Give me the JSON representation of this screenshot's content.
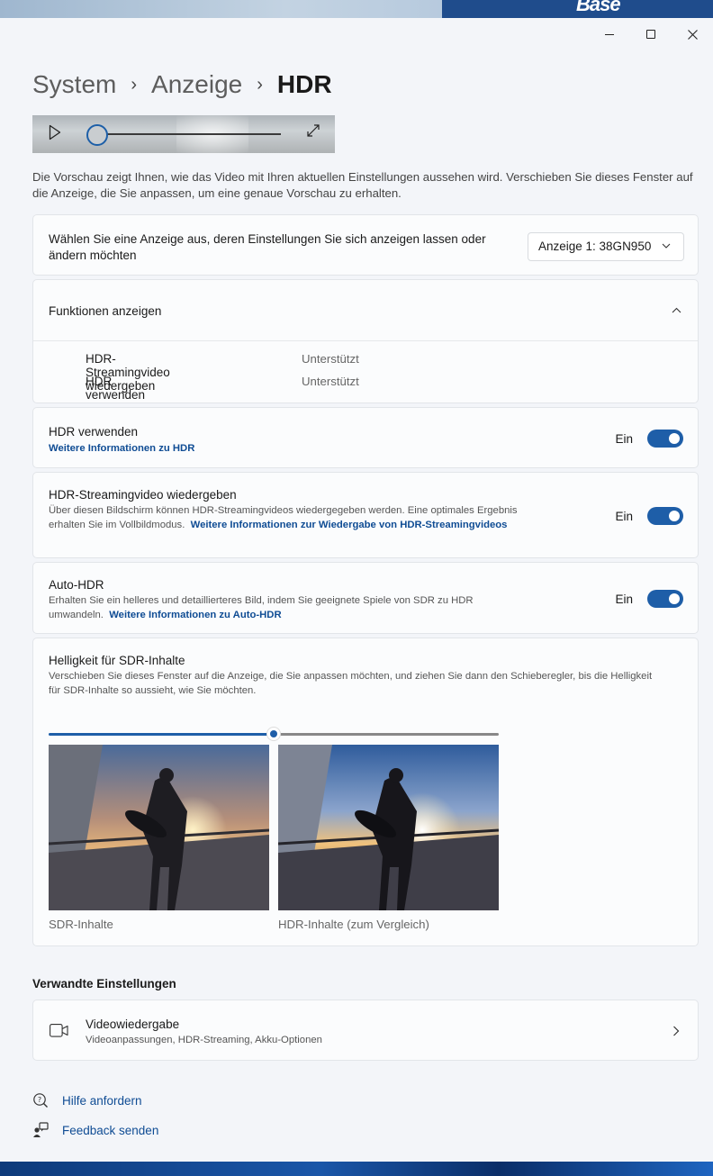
{
  "topbar": {
    "brand": "Base"
  },
  "breadcrumb": {
    "items": [
      "System",
      "Anzeige"
    ],
    "current": "HDR",
    "separator": "›"
  },
  "preview": {
    "progress": 0.0,
    "description": "Die Vorschau zeigt Ihnen, wie das Video mit Ihren aktuellen Einstellungen aussehen wird. Verschieben Sie dieses Fenster auf die Anzeige, die Sie anpassen, um eine genaue Vorschau zu erhalten."
  },
  "display_select": {
    "label": "Wählen Sie eine Anzeige aus, deren Einstellungen Sie sich anzeigen lassen oder ändern möchten",
    "value": "Anzeige 1: 38GN950"
  },
  "features": {
    "header": "Funktionen anzeigen",
    "rows": [
      {
        "label": "HDR-Streamingvideo wiedergeben",
        "value": "Unterstützt"
      },
      {
        "label": "HDR verwenden",
        "value": "Unterstützt"
      }
    ]
  },
  "settings": {
    "hdr": {
      "title": "HDR verwenden",
      "link": "Weitere Informationen zu HDR",
      "state": "Ein",
      "on": true
    },
    "streaming": {
      "title": "HDR-Streamingvideo wiedergeben",
      "text": "Über diesen Bildschirm können HDR-Streamingvideos wiedergegeben werden. Eine optimales Ergebnis erhalten Sie im Vollbildmodus.",
      "link": "Weitere Informationen zur Wiedergabe von HDR-Streamingvideos",
      "state": "Ein",
      "on": true
    },
    "autohdr": {
      "title": "Auto-HDR",
      "text": "Erhalten Sie ein helleres und detaillierteres Bild, indem Sie geeignete Spiele von SDR zu HDR umwandeln.",
      "link": "Weitere Informationen zu Auto-HDR",
      "state": "Ein",
      "on": true
    }
  },
  "sdr_brightness": {
    "title": "Helligkeit für SDR-Inhalte",
    "text": "Verschieben Sie dieses Fenster auf die Anzeige, die Sie anpassen möchten, und ziehen Sie dann den Schieberegler, bis die Helligkeit für SDR-Inhalte so aussieht, wie Sie möchten.",
    "slider_value": 0.5,
    "captions": {
      "sdr": "SDR-Inhalte",
      "hdr": "HDR-Inhalte (zum Vergleich)"
    }
  },
  "related": {
    "heading": "Verwandte Einstellungen",
    "item": {
      "title": "Videowiedergabe",
      "subtitle": "Videoanpassungen, HDR-Streaming, Akku-Optionen"
    }
  },
  "footer": {
    "help": "Hilfe anfordern",
    "feedback": "Feedback senden"
  },
  "colors": {
    "accent": "#1e5ea8",
    "link": "#0f4c94",
    "background": "#f3f5f9",
    "card": "#fbfcfd"
  },
  "icons": {
    "play": "play-icon",
    "expand": "expand-icon",
    "chevron_down": "chevron-down-icon",
    "chevron_up": "chevron-up-icon",
    "chevron_right": "chevron-right-icon",
    "camera": "video-camera-icon",
    "help": "help-icon",
    "feedback": "feedback-icon"
  }
}
